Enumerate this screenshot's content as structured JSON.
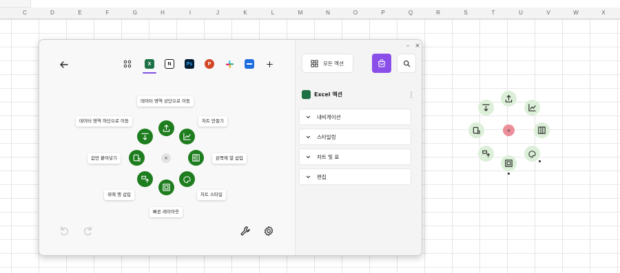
{
  "spreadsheet": {
    "columns": [
      "C",
      "D",
      "E",
      "F",
      "G",
      "H",
      "I",
      "J",
      "K",
      "L",
      "M",
      "N",
      "O",
      "P",
      "Q",
      "R",
      "S",
      "T",
      "U",
      "V",
      "W",
      "X"
    ]
  },
  "window": {
    "minimize_glyph": "–",
    "close_glyph": "×"
  },
  "toolbar": {
    "back_icon": "arrow-left-icon",
    "apps": [
      {
        "name": "grid-apps-icon"
      },
      {
        "name": "excel-icon",
        "color": "#1e7145",
        "letter": "X"
      },
      {
        "name": "notion-icon",
        "color": "#111111",
        "letter": "N"
      },
      {
        "name": "photoshop-icon",
        "color": "#001d34",
        "letter": "Ps"
      },
      {
        "name": "powerpoint-icon",
        "color": "#d24726",
        "letter": "P"
      },
      {
        "name": "slack-icon"
      },
      {
        "name": "app-blue-icon",
        "color": "#1e6fe0"
      },
      {
        "name": "add-app-icon"
      }
    ],
    "accent_color": "#7a4fe0"
  },
  "radial_menu": {
    "center_glyph": "×",
    "labels": {
      "top": "데이터 영역 상단으로 이동",
      "top_left": "데이터 영역 하단으로 이동",
      "top_right": "차트 만들기",
      "left": "값만 붙여넣기",
      "right": "왼쪽에 열 삽입",
      "bottom_left": "위에 행 삽입",
      "bottom_right": "차트 스타일",
      "bottom": "빠른 레이아웃"
    },
    "button_color": "#1e7d1e"
  },
  "right_panel": {
    "all_actions_label": "모든 액션",
    "section_title": "Excel 액션",
    "accordion": [
      {
        "label": "내비게이션"
      },
      {
        "label": "스타일링"
      },
      {
        "label": "차트 및 표"
      },
      {
        "label": "편집"
      }
    ],
    "bag_color": "#8a4fe8"
  },
  "floating_menu": {
    "center_glyph": "×",
    "center_color": "#ec8f9a",
    "button_color": "#dcefd8"
  }
}
